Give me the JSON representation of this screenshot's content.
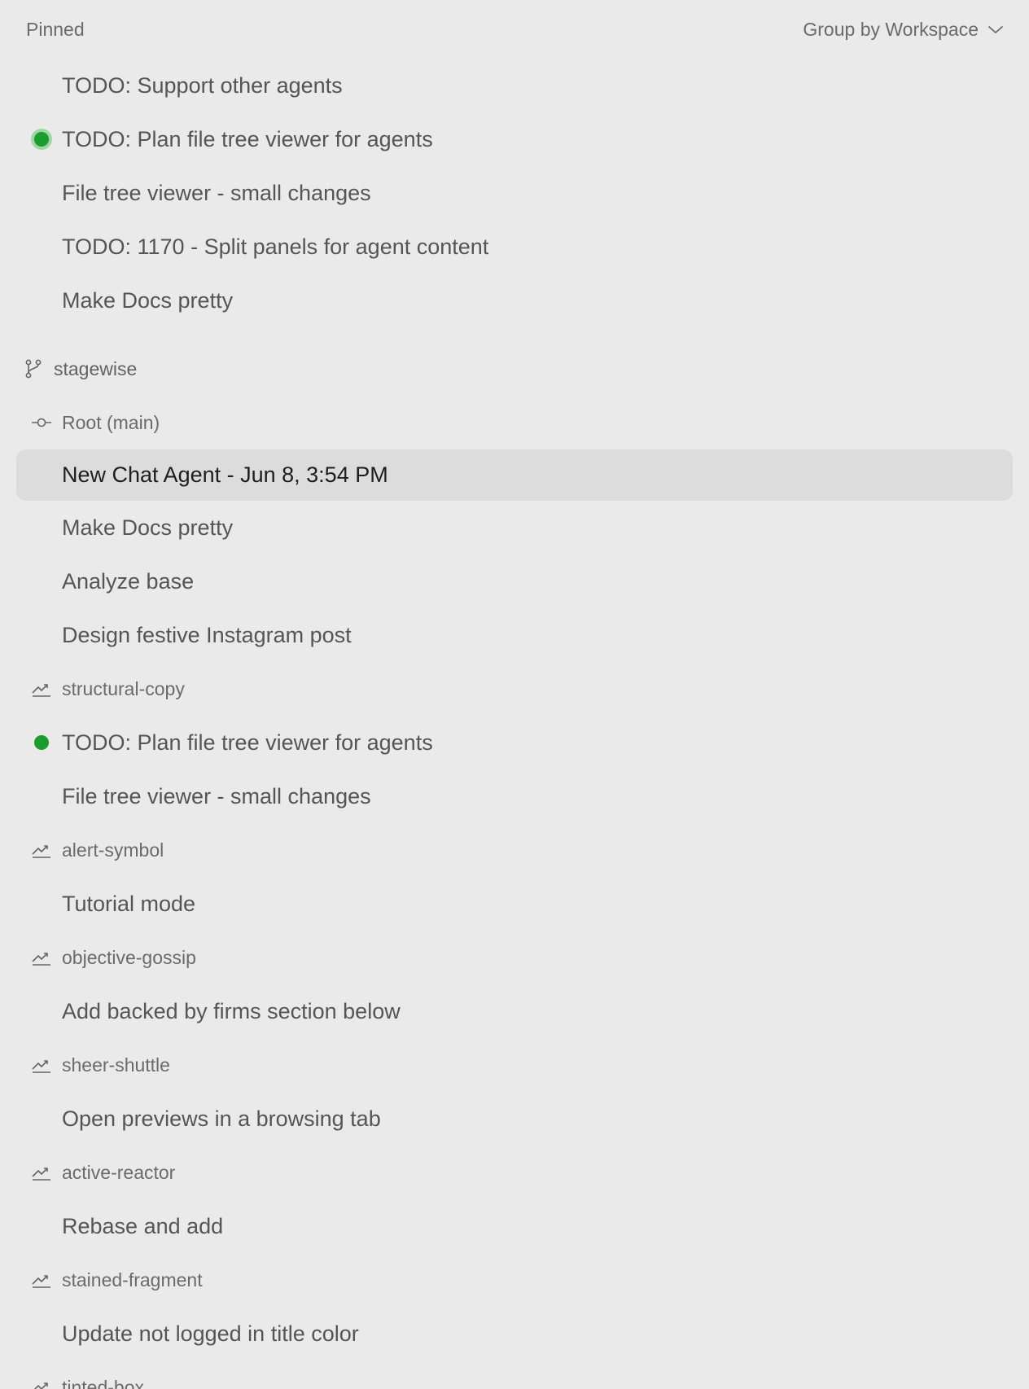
{
  "header": {
    "pinned_label": "Pinned",
    "group_by_label": "Group by Workspace"
  },
  "pinned": [
    {
      "title": "TODO: Support other agents",
      "status": ""
    },
    {
      "title": "TODO: Plan file tree viewer for agents",
      "status": "active"
    },
    {
      "title": "File tree viewer - small changes",
      "status": ""
    },
    {
      "title": "TODO: 1170 - Split panels for agent content",
      "status": ""
    },
    {
      "title": "Make Docs pretty",
      "status": ""
    }
  ],
  "workspace": {
    "name": "stagewise",
    "branches": [
      {
        "name": "Root (main)",
        "icon": "commit-icon",
        "items": [
          {
            "title": "New Chat Agent - Jun 8, 3:54 PM",
            "selected": true
          },
          {
            "title": "Make Docs pretty"
          },
          {
            "title": "Analyze base"
          },
          {
            "title": "Design festive Instagram post"
          }
        ]
      },
      {
        "name": "structural-copy",
        "icon": "worktree-icon",
        "items": [
          {
            "title": "TODO: Plan file tree viewer for agents",
            "status": "running"
          },
          {
            "title": "File tree viewer - small changes"
          }
        ]
      },
      {
        "name": "alert-symbol",
        "icon": "worktree-icon",
        "items": [
          {
            "title": "Tutorial mode"
          }
        ]
      },
      {
        "name": "objective-gossip",
        "icon": "worktree-icon",
        "items": [
          {
            "title": "Add backed by firms section below"
          }
        ]
      },
      {
        "name": "sheer-shuttle",
        "icon": "worktree-icon",
        "items": [
          {
            "title": "Open previews in a browsing tab"
          }
        ]
      },
      {
        "name": "active-reactor",
        "icon": "worktree-icon",
        "items": [
          {
            "title": "Rebase and add"
          }
        ]
      },
      {
        "name": "stained-fragment",
        "icon": "worktree-icon",
        "items": [
          {
            "title": "Update not logged in title color"
          }
        ]
      },
      {
        "name": "tinted-box",
        "icon": "worktree-icon",
        "items": []
      }
    ]
  },
  "colors": {
    "background": "#eaeaea",
    "selected_row": "#dcdcdc",
    "status_green": "#1c9b2e",
    "status_halo": "#9fd6a4"
  }
}
